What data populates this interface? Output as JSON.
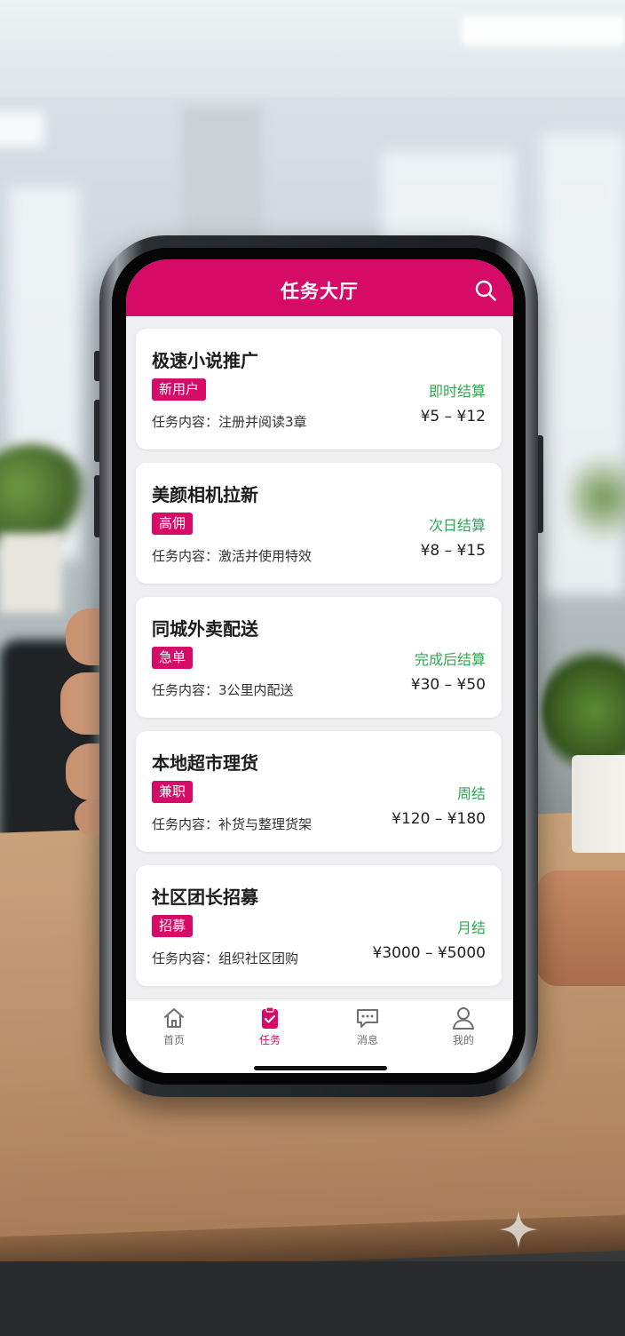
{
  "colors": {
    "primary": "#d60a67",
    "settlement_green": "#2fa84f",
    "page_background": "#efeff2"
  },
  "header": {
    "title": "任务大厅",
    "search_icon": "search-icon"
  },
  "tasks": [
    {
      "name": "极速小说推广",
      "tag": "新用户",
      "settlement": "即时结算",
      "content": "任务内容：注册并阅读3章",
      "price": "¥5 – ¥12"
    },
    {
      "name": "美颜相机拉新",
      "tag": "高佣",
      "settlement": "次日结算",
      "content": "任务内容：激活并使用特效",
      "price": "¥8 – ¥15"
    },
    {
      "name": "同城外卖配送",
      "tag": "急单",
      "settlement": "完成后结算",
      "content": "任务内容：3公里内配送",
      "price": "¥30 – ¥50"
    },
    {
      "name": "本地超市理货",
      "tag": "兼职",
      "settlement": "周结",
      "content": "任务内容：补货与整理货架",
      "price": "¥120 – ¥180"
    },
    {
      "name": "社区团长招募",
      "tag": "招募",
      "settlement": "月结",
      "content": "任务内容：组织社区团购",
      "price": "¥3000 – ¥5000"
    }
  ],
  "tabbar": {
    "items": [
      {
        "label": "首页",
        "icon": "home-icon",
        "active": false
      },
      {
        "label": "任务",
        "icon": "task-clipboard-icon",
        "active": true
      },
      {
        "label": "消息",
        "icon": "message-icon",
        "active": false
      },
      {
        "label": "我的",
        "icon": "user-icon",
        "active": false
      }
    ]
  }
}
